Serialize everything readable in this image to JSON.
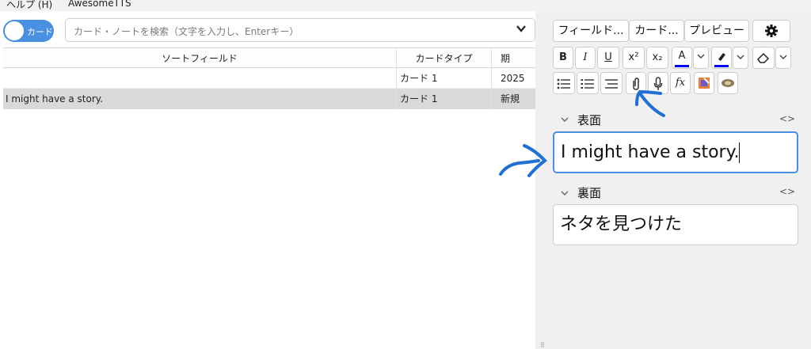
{
  "menu": {
    "help": "ヘルプ (H)",
    "awesometts": "AwesomeTTS"
  },
  "toolbar": {
    "toggle_label": "カード",
    "search_placeholder": "カード・ノートを検索（文字を入力し、Enterキー）",
    "dropdown_icon": "chevron-down-icon"
  },
  "table": {
    "columns": [
      "ソートフィールド",
      "カードタイプ",
      "期"
    ],
    "rows": [
      {
        "sort_field": "",
        "card_type": "カード 1",
        "due": "2025"
      },
      {
        "sort_field": "I might have a story.",
        "card_type": "カード 1",
        "due": "新規"
      }
    ]
  },
  "editor": {
    "buttons": {
      "fields": "フィールド...",
      "cards": "カード...",
      "preview": "プレビュー",
      "settings_icon": "gear-icon"
    },
    "format": {
      "bold": "B",
      "italic": "I",
      "underline": "U",
      "superscript": "x²",
      "subscript": "x₂",
      "text_color": "A",
      "text_color_bar": "#0000ff",
      "highlight_bar": "#0000ff",
      "unordered_list_icon": "list-icon",
      "ordered_list_icon": "ordered-list-icon",
      "align_icon": "align-icon",
      "attach_icon": "paperclip-icon",
      "record_icon": "microphone-icon",
      "math": "fx"
    },
    "fields": [
      {
        "label": "表面",
        "value": "I might have a story."
      },
      {
        "label": "裏面",
        "value": "ネタを見つけた"
      }
    ],
    "html_toggle": "<>"
  },
  "annotation_color": "#1f6fd6"
}
